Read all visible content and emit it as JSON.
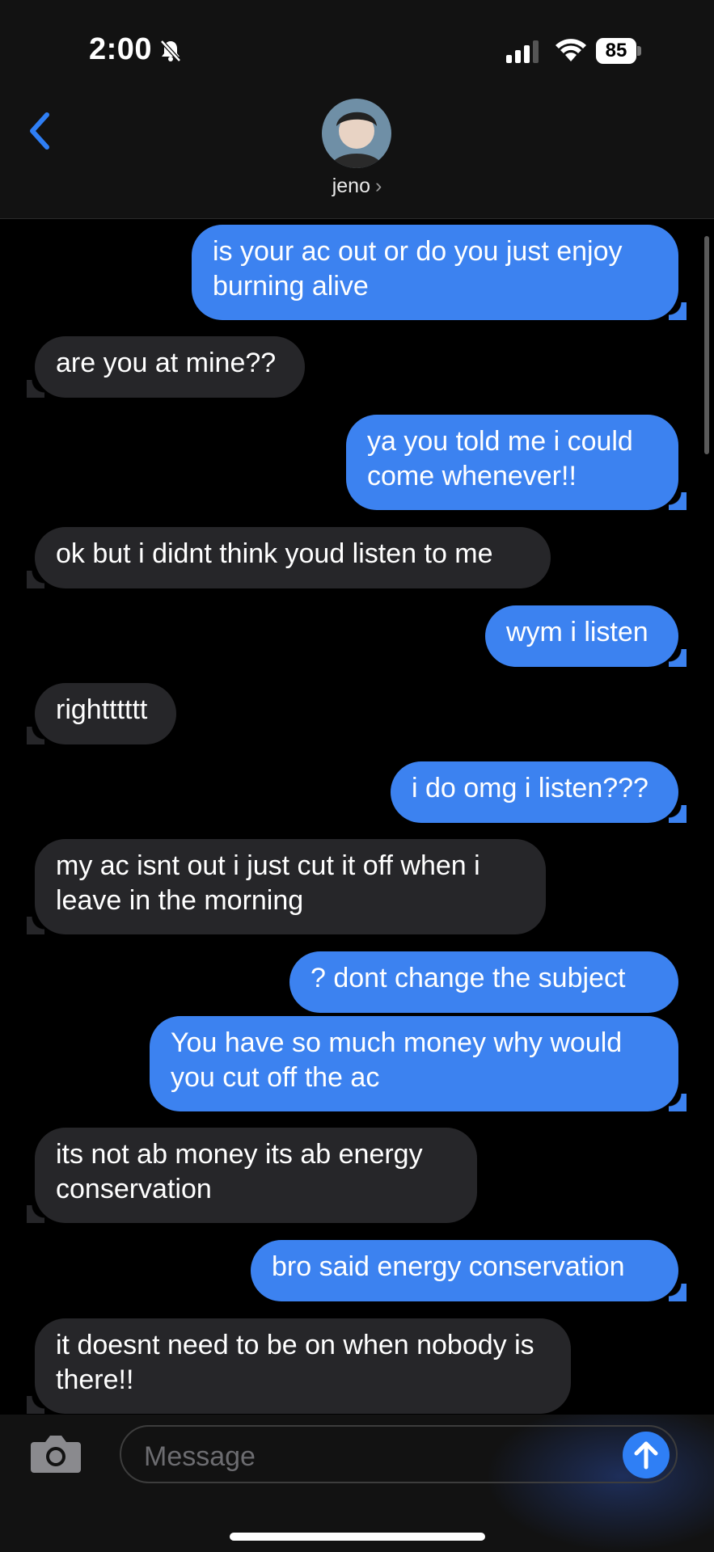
{
  "status_bar": {
    "time": "2:00",
    "battery": "85"
  },
  "header": {
    "contact_name": "jeno",
    "chevron": "›"
  },
  "messages": [
    {
      "side": "out",
      "text": "is your ac out or do you just enjoy burning alive"
    },
    {
      "side": "in",
      "text": "are you at mine??"
    },
    {
      "side": "out",
      "text": "ya you told me i could come whenever!!"
    },
    {
      "side": "in",
      "text": "ok but i didnt think youd listen to me"
    },
    {
      "side": "out",
      "text": "wym i listen"
    },
    {
      "side": "in",
      "text": "rightttttt"
    },
    {
      "side": "out",
      "text": "i do omg i listen???"
    },
    {
      "side": "in",
      "text": "my ac isnt out i just cut it off when i leave in the morning"
    },
    {
      "side": "out",
      "text": "? dont change the subject"
    },
    {
      "side": "out",
      "text": "You have so much money why would you cut off the ac"
    },
    {
      "side": "in",
      "text": "its not ab money its ab energy conservation"
    },
    {
      "side": "out",
      "text": "bro said energy conservation"
    },
    {
      "side": "in",
      "text": "it doesnt need to be on when nobody is there!!"
    }
  ],
  "composer": {
    "placeholder": "Message"
  },
  "icons": {
    "silent": "bell-slash-icon",
    "back": "chevron-left-icon",
    "camera": "camera-icon",
    "send": "arrow-up-icon"
  },
  "colors": {
    "outgoing_bubble": "#3c82f0",
    "incoming_bubble": "#262629",
    "accent": "#2f7ff5"
  }
}
